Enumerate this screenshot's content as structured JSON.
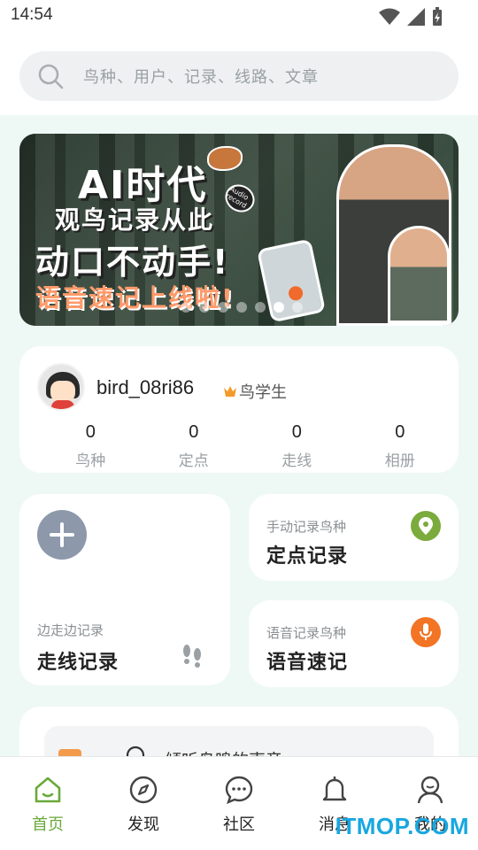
{
  "status_bar": {
    "time": "14:54"
  },
  "search": {
    "placeholder": "鸟种、用户、记录、线路、文章"
  },
  "banner": {
    "line1": "AI时代",
    "line2": "观鸟记录从此",
    "line3": "动口不动手!",
    "line4": "语音速记上线啦!",
    "badge": "Audio record",
    "slide_count": 7,
    "active_slide": 5
  },
  "user": {
    "username": "bird_08ri86",
    "level": "鸟学生",
    "stats": [
      {
        "value": "0",
        "label": "鸟种"
      },
      {
        "value": "0",
        "label": "定点"
      },
      {
        "value": "0",
        "label": "走线"
      },
      {
        "value": "0",
        "label": "相册"
      }
    ]
  },
  "actions": {
    "route": {
      "subtitle": "边走边记录",
      "title": "走线记录"
    },
    "point": {
      "subtitle": "手动记录鸟种",
      "title": "定点记录",
      "color": "#7bab3c"
    },
    "voice": {
      "subtitle": "语音记录鸟种",
      "title": "语音速记",
      "color": "#f27424"
    }
  },
  "feature": {
    "text": "倾听鸟鸣的声音"
  },
  "tabs": [
    {
      "label": "首页",
      "icon": "home-icon",
      "active": true
    },
    {
      "label": "发现",
      "icon": "compass-icon",
      "active": false
    },
    {
      "label": "社区",
      "icon": "chat-icon",
      "active": false
    },
    {
      "label": "消息",
      "icon": "bell-icon",
      "active": false
    },
    {
      "label": "我的",
      "icon": "profile-icon",
      "active": false
    }
  ],
  "watermark": "ITMOP.COM",
  "colors": {
    "accent": "#6aa93a",
    "background": "#eef9f6"
  }
}
